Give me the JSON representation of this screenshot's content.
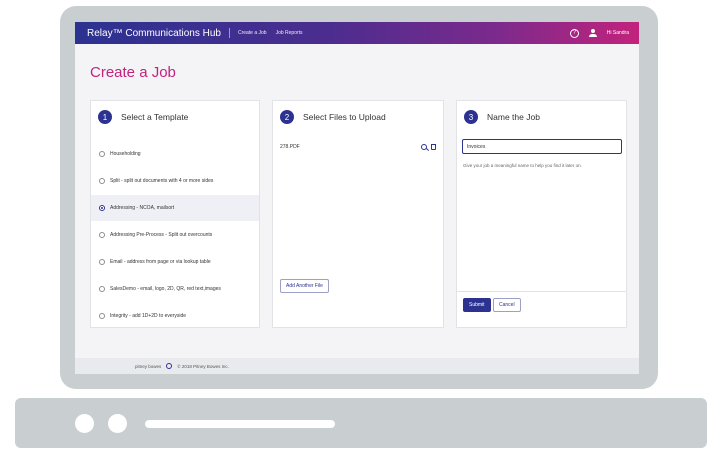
{
  "header": {
    "brand": "Relay™ Communications Hub",
    "nav": [
      "Create a Job",
      "Job Reports"
    ],
    "user": "Hi Sandra"
  },
  "page_title": "Create a Job",
  "steps": [
    {
      "number": "1",
      "title": "Select a Template"
    },
    {
      "number": "2",
      "title": "Select Files to Upload"
    },
    {
      "number": "3",
      "title": "Name the Job"
    }
  ],
  "templates": [
    {
      "label": "Householding",
      "selected": false
    },
    {
      "label": "Split - split out documents with 4 or more sides",
      "selected": false
    },
    {
      "label": "Addressing - NCOA, mailsort",
      "selected": true
    },
    {
      "label": "Addressing Pre-Process - Split out overcounts",
      "selected": false
    },
    {
      "label": "Email - address from page or via lookup table",
      "selected": false
    },
    {
      "label": "SalesDemo - email, logo, 2D, QR, red text,images",
      "selected": false
    },
    {
      "label": "Integrity - add 1D+2D to everyside",
      "selected": false
    }
  ],
  "files": {
    "items": [
      "278.PDF"
    ],
    "add_button": "Add Another File"
  },
  "job_name": {
    "value": "Invoices",
    "hint": "Give your job a meaningful name to help you find it later on.",
    "submit": "Submit",
    "cancel": "Cancel"
  },
  "footer": {
    "logo": "pitney bowes",
    "copyright": "© 2018 Pitney Bowes Inc."
  },
  "colors": {
    "primary": "#2c3290",
    "accent": "#c2237c"
  }
}
